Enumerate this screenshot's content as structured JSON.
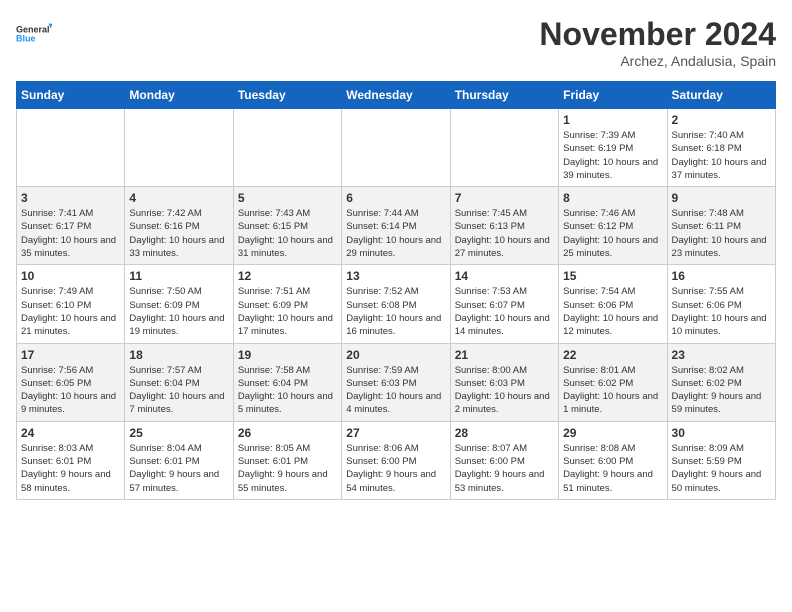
{
  "logo": {
    "line1": "General",
    "line2": "Blue"
  },
  "title": "November 2024",
  "location": "Archez, Andalusia, Spain",
  "weekdays": [
    "Sunday",
    "Monday",
    "Tuesday",
    "Wednesday",
    "Thursday",
    "Friday",
    "Saturday"
  ],
  "weeks": [
    [
      {
        "day": "",
        "info": ""
      },
      {
        "day": "",
        "info": ""
      },
      {
        "day": "",
        "info": ""
      },
      {
        "day": "",
        "info": ""
      },
      {
        "day": "",
        "info": ""
      },
      {
        "day": "1",
        "info": "Sunrise: 7:39 AM\nSunset: 6:19 PM\nDaylight: 10 hours and 39 minutes."
      },
      {
        "day": "2",
        "info": "Sunrise: 7:40 AM\nSunset: 6:18 PM\nDaylight: 10 hours and 37 minutes."
      }
    ],
    [
      {
        "day": "3",
        "info": "Sunrise: 7:41 AM\nSunset: 6:17 PM\nDaylight: 10 hours and 35 minutes."
      },
      {
        "day": "4",
        "info": "Sunrise: 7:42 AM\nSunset: 6:16 PM\nDaylight: 10 hours and 33 minutes."
      },
      {
        "day": "5",
        "info": "Sunrise: 7:43 AM\nSunset: 6:15 PM\nDaylight: 10 hours and 31 minutes."
      },
      {
        "day": "6",
        "info": "Sunrise: 7:44 AM\nSunset: 6:14 PM\nDaylight: 10 hours and 29 minutes."
      },
      {
        "day": "7",
        "info": "Sunrise: 7:45 AM\nSunset: 6:13 PM\nDaylight: 10 hours and 27 minutes."
      },
      {
        "day": "8",
        "info": "Sunrise: 7:46 AM\nSunset: 6:12 PM\nDaylight: 10 hours and 25 minutes."
      },
      {
        "day": "9",
        "info": "Sunrise: 7:48 AM\nSunset: 6:11 PM\nDaylight: 10 hours and 23 minutes."
      }
    ],
    [
      {
        "day": "10",
        "info": "Sunrise: 7:49 AM\nSunset: 6:10 PM\nDaylight: 10 hours and 21 minutes."
      },
      {
        "day": "11",
        "info": "Sunrise: 7:50 AM\nSunset: 6:09 PM\nDaylight: 10 hours and 19 minutes."
      },
      {
        "day": "12",
        "info": "Sunrise: 7:51 AM\nSunset: 6:09 PM\nDaylight: 10 hours and 17 minutes."
      },
      {
        "day": "13",
        "info": "Sunrise: 7:52 AM\nSunset: 6:08 PM\nDaylight: 10 hours and 16 minutes."
      },
      {
        "day": "14",
        "info": "Sunrise: 7:53 AM\nSunset: 6:07 PM\nDaylight: 10 hours and 14 minutes."
      },
      {
        "day": "15",
        "info": "Sunrise: 7:54 AM\nSunset: 6:06 PM\nDaylight: 10 hours and 12 minutes."
      },
      {
        "day": "16",
        "info": "Sunrise: 7:55 AM\nSunset: 6:06 PM\nDaylight: 10 hours and 10 minutes."
      }
    ],
    [
      {
        "day": "17",
        "info": "Sunrise: 7:56 AM\nSunset: 6:05 PM\nDaylight: 10 hours and 9 minutes."
      },
      {
        "day": "18",
        "info": "Sunrise: 7:57 AM\nSunset: 6:04 PM\nDaylight: 10 hours and 7 minutes."
      },
      {
        "day": "19",
        "info": "Sunrise: 7:58 AM\nSunset: 6:04 PM\nDaylight: 10 hours and 5 minutes."
      },
      {
        "day": "20",
        "info": "Sunrise: 7:59 AM\nSunset: 6:03 PM\nDaylight: 10 hours and 4 minutes."
      },
      {
        "day": "21",
        "info": "Sunrise: 8:00 AM\nSunset: 6:03 PM\nDaylight: 10 hours and 2 minutes."
      },
      {
        "day": "22",
        "info": "Sunrise: 8:01 AM\nSunset: 6:02 PM\nDaylight: 10 hours and 1 minute."
      },
      {
        "day": "23",
        "info": "Sunrise: 8:02 AM\nSunset: 6:02 PM\nDaylight: 9 hours and 59 minutes."
      }
    ],
    [
      {
        "day": "24",
        "info": "Sunrise: 8:03 AM\nSunset: 6:01 PM\nDaylight: 9 hours and 58 minutes."
      },
      {
        "day": "25",
        "info": "Sunrise: 8:04 AM\nSunset: 6:01 PM\nDaylight: 9 hours and 57 minutes."
      },
      {
        "day": "26",
        "info": "Sunrise: 8:05 AM\nSunset: 6:01 PM\nDaylight: 9 hours and 55 minutes."
      },
      {
        "day": "27",
        "info": "Sunrise: 8:06 AM\nSunset: 6:00 PM\nDaylight: 9 hours and 54 minutes."
      },
      {
        "day": "28",
        "info": "Sunrise: 8:07 AM\nSunset: 6:00 PM\nDaylight: 9 hours and 53 minutes."
      },
      {
        "day": "29",
        "info": "Sunrise: 8:08 AM\nSunset: 6:00 PM\nDaylight: 9 hours and 51 minutes."
      },
      {
        "day": "30",
        "info": "Sunrise: 8:09 AM\nSunset: 5:59 PM\nDaylight: 9 hours and 50 minutes."
      }
    ]
  ]
}
